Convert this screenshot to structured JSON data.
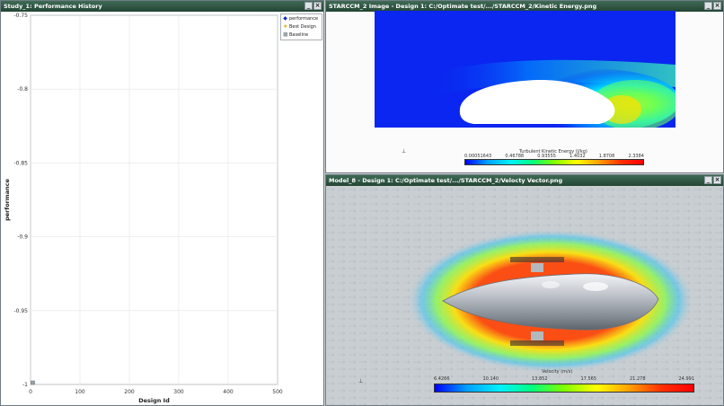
{
  "left_panel": {
    "title": "Study_1: Performance History",
    "buttons": [
      "_",
      "×"
    ],
    "legend": [
      {
        "label": "performance",
        "color": "#1a2cb8",
        "symbol": "◆"
      },
      {
        "label": "Best Design",
        "color": "#e0b000",
        "symbol": "★"
      },
      {
        "label": "Baseline",
        "color": "#9aa4aa",
        "symbol": "■"
      }
    ]
  },
  "top_panel": {
    "title": "STARCCM_2 Image - Design 1: C:/Optimate test/.../STARCCM_2/Kinetic Energy.png",
    "buttons": [
      "_",
      "×"
    ],
    "colorbar_title": "Turbulent Kinetic Energy (J/kg)",
    "colorbar_ticks": [
      "0.00051643",
      "0.46788",
      "0.93555",
      "1.4032",
      "1.8708",
      "2.3384"
    ]
  },
  "bottom_panel": {
    "title": "Model_8 - Design 1: C:/Optimate test/.../STARCCM_2/Velocty Vector.png",
    "buttons": [
      "_",
      "×"
    ],
    "colorbar_title": "Velocity (m/s)",
    "colorbar_ticks": [
      "6.4266",
      "10.140",
      "13.852",
      "17.565",
      "21.278",
      "24.991"
    ]
  },
  "chart_data": {
    "type": "scatter",
    "title": "",
    "xlabel": "Design Id",
    "ylabel": "performance",
    "xlim": [
      0,
      500
    ],
    "ylim": [
      -1,
      -0.75
    ],
    "xticks": [
      0,
      100,
      200,
      300,
      400,
      500
    ],
    "yticks": [
      -0.75,
      -0.8,
      -0.85,
      -0.9,
      -0.95,
      -1
    ],
    "ytick_labels": [
      "-0.75",
      "-0.8",
      "-0.85",
      "-0.9",
      "-0.95",
      "-1"
    ],
    "grid": true,
    "legend_position": "top-right",
    "series": [
      {
        "name": "performance",
        "x": [
          1
        ],
        "y": [
          -1
        ]
      },
      {
        "name": "Best Design",
        "x": [
          1
        ],
        "y": [
          -1
        ]
      },
      {
        "name": "Baseline",
        "x": [
          1
        ],
        "y": [
          -1
        ]
      }
    ]
  }
}
